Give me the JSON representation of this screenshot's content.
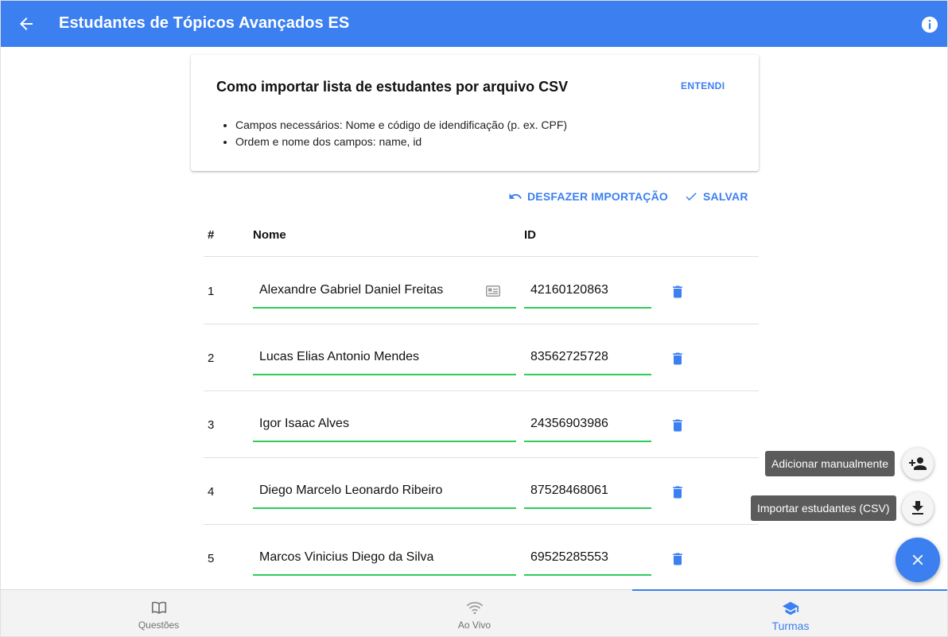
{
  "appbar": {
    "title": "Estudantes de Tópicos Avançados ES",
    "back_icon": "arrow-left-icon",
    "info_icon": "info-icon"
  },
  "help_card": {
    "title": "Como importar lista de estudantes por arquivo CSV",
    "dismiss_label": "ENTENDI",
    "bullets": [
      "Campos necessários: Nome e código de idendificação (p. ex. CPF)",
      "Ordem e nome dos campos: name, id"
    ]
  },
  "actions": {
    "undo_label": "DESFAZER IMPORTAÇÃO",
    "save_label": "SALVAR"
  },
  "table": {
    "headers": [
      "#",
      "Nome",
      "ID"
    ],
    "rows": [
      {
        "num": "1",
        "name": "Alexandre Gabriel Daniel Freitas",
        "id": "42160120863"
      },
      {
        "num": "2",
        "name": "Lucas Elias Antonio Mendes",
        "id": "83562725728"
      },
      {
        "num": "3",
        "name": "Igor Isaac Alves",
        "id": "24356903986"
      },
      {
        "num": "4",
        "name": "Diego Marcelo Leonardo Ribeiro",
        "id": "87528468061"
      },
      {
        "num": "5",
        "name": "Marcos Vinicius Diego da Silva",
        "id": "69525285553"
      }
    ]
  },
  "speed_dial": {
    "add_manual_label": "Adicionar manualmente",
    "import_csv_label": "Importar estudantes (CSV)"
  },
  "bottom_nav": {
    "items": [
      {
        "label": "Questões",
        "icon": "book-icon"
      },
      {
        "label": "Ao Vivo",
        "icon": "wifi-icon"
      },
      {
        "label": "Turmas",
        "icon": "school-icon"
      }
    ],
    "active": "Turmas"
  },
  "colors": {
    "primary": "#3b7ff0",
    "field_underline": "#2ecc5a",
    "tooltip": "#5b5b5b"
  }
}
